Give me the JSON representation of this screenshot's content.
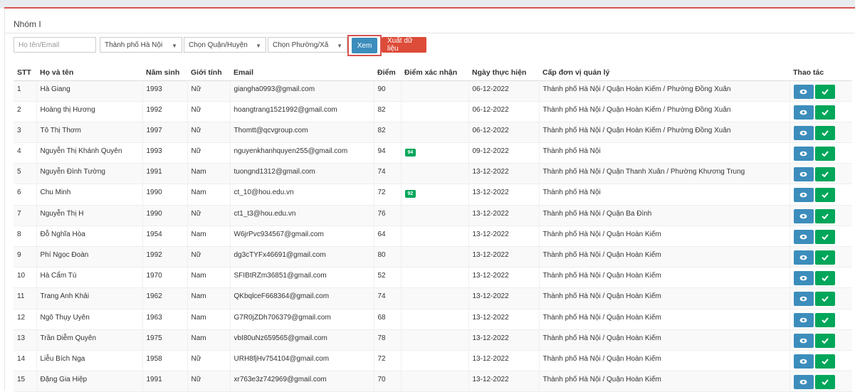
{
  "panel": {
    "title": "Nhóm I"
  },
  "filters": {
    "name_placeholder": "Họ tên/Email",
    "city": "Thành phố Hà Nội",
    "district": "Chọn Quận/Huyện",
    "ward": "Chọn Phường/Xã",
    "view_label": "Xem",
    "export_label": "Xuất dữ liệu"
  },
  "table": {
    "headers": [
      "STT",
      "Họ và tên",
      "Năm sinh",
      "Giới tính",
      "Email",
      "Điểm",
      "Điểm xác nhận",
      "Ngày thực hiện",
      "Cấp đơn vị quản lý",
      "Thao tác"
    ],
    "rows": [
      [
        "1",
        "Hà Giang",
        "1993",
        "Nữ",
        "giangha0993@gmail.com",
        "90",
        "",
        "06-12-2022",
        "Thành phố Hà Nội / Quận Hoàn Kiếm / Phường Đồng Xuân"
      ],
      [
        "2",
        "Hoàng thị Hương",
        "1992",
        "Nữ",
        "hoangtrang1521992@gmail.com",
        "82",
        "",
        "06-12-2022",
        "Thành phố Hà Nội / Quận Hoàn Kiếm / Phường Đồng Xuân"
      ],
      [
        "3",
        "Tô Thị Thơm",
        "1997",
        "Nữ",
        "Thomtt@qcvgroup.com",
        "82",
        "",
        "06-12-2022",
        "Thành phố Hà Nội / Quận Hoàn Kiếm / Phường Đồng Xuân"
      ],
      [
        "4",
        "Nguyễn Thị Khánh Quyên",
        "1993",
        "Nữ",
        "nguyenkhanhquyen255@gmail.com",
        "94",
        "94",
        "09-12-2022",
        "Thành phố Hà Nội"
      ],
      [
        "5",
        "Nguyễn Đình Tường",
        "1991",
        "Nam",
        "tuongnd1312@gmail.com",
        "74",
        "",
        "13-12-2022",
        "Thành phố Hà Nội / Quận Thanh Xuân / Phường Khương Trung"
      ],
      [
        "6",
        "Chu Minh",
        "1990",
        "Nam",
        "ct_10@hou.edu.vn",
        "72",
        "92",
        "13-12-2022",
        "Thành phố Hà Nội"
      ],
      [
        "7",
        "Nguyễn Thị H",
        "1990",
        "Nữ",
        "ct1_t3@hou.edu.vn",
        "76",
        "",
        "13-12-2022",
        "Thành phố Hà Nội / Quận Ba Đình"
      ],
      [
        "8",
        "Đỗ Nghĩa Hòa",
        "1954",
        "Nam",
        "W6jrPvc934567@gmail.com",
        "64",
        "",
        "13-12-2022",
        "Thành phố Hà Nội / Quận Hoàn Kiếm"
      ],
      [
        "9",
        "Phí Ngọc Đoàn",
        "1992",
        "Nữ",
        "dg3cTYFx46691@gmail.com",
        "80",
        "",
        "13-12-2022",
        "Thành phố Hà Nội / Quận Hoàn Kiếm"
      ],
      [
        "10",
        "Hà Cẩm Tú",
        "1970",
        "Nam",
        "SFIBtRZm36851@gmail.com",
        "52",
        "",
        "13-12-2022",
        "Thành phố Hà Nội / Quận Hoàn Kiếm"
      ],
      [
        "11",
        "Trang Anh Khải",
        "1962",
        "Nam",
        "QKbqlceF668364@gmail.com",
        "74",
        "",
        "13-12-2022",
        "Thành phố Hà Nội / Quận Hoàn Kiếm"
      ],
      [
        "12",
        "Ngô Thụy Uyên",
        "1963",
        "Nam",
        "G7R0jZDh706379@gmail.com",
        "68",
        "",
        "13-12-2022",
        "Thành phố Hà Nội / Quận Hoàn Kiếm"
      ],
      [
        "13",
        "Trần Diễm Quyên",
        "1975",
        "Nam",
        "vbI80uNz659565@gmail.com",
        "78",
        "",
        "13-12-2022",
        "Thành phố Hà Nội / Quận Hoàn Kiếm"
      ],
      [
        "14",
        "Liễu Bích Nga",
        "1958",
        "Nữ",
        "URH8fjHv754104@gmail.com",
        "72",
        "",
        "13-12-2022",
        "Thành phố Hà Nội / Quận Hoàn Kiếm"
      ],
      [
        "15",
        "Đặng Gia Hiệp",
        "1991",
        "Nữ",
        "xr763e3z742969@gmail.com",
        "70",
        "",
        "13-12-2022",
        "Thành phố Hà Nội / Quận Hoàn Kiếm"
      ]
    ]
  },
  "colors": {
    "primary": "#3c8dbc",
    "success": "#00a65a",
    "danger": "#dd4b39"
  },
  "icons": {
    "view": "eye-icon",
    "confirm": "check-icon"
  }
}
